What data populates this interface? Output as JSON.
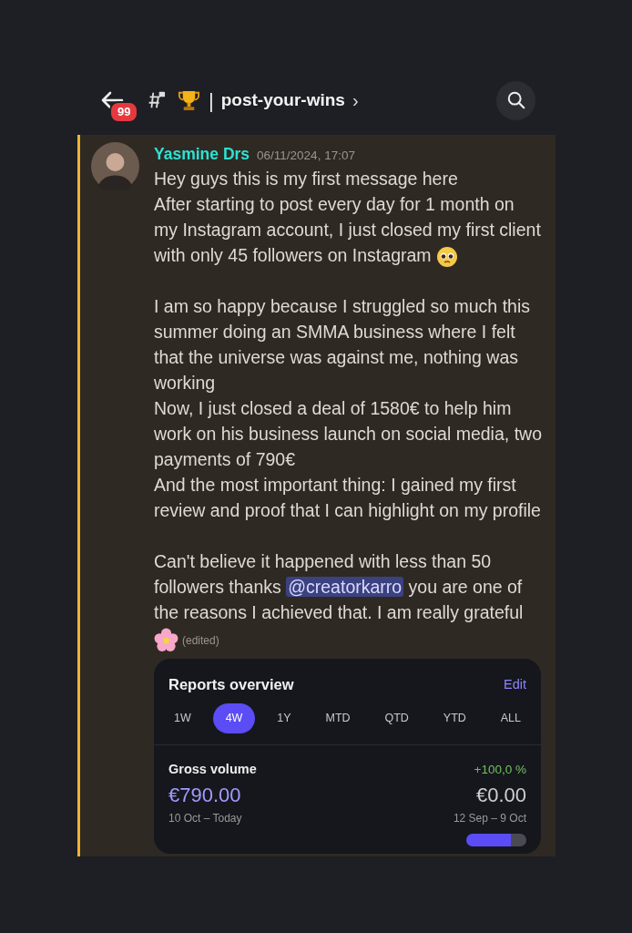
{
  "header": {
    "unread_badge": "99",
    "separator": "|",
    "channel_name": "post-your-wins",
    "chevron": "›"
  },
  "message": {
    "author": "Yasmine Drs",
    "timestamp": "06/11/2024, 17:07",
    "edited": "(edited)",
    "paragraphs": [
      {
        "lines": [
          {
            "text": "Hey guys this is my first message here",
            "end_icon": false
          },
          {
            "text": "After starting to post every day for 1 month on my Instagram account,  I just closed my first client with only 45 followers on Instagram",
            "end_icon": true
          }
        ]
      },
      {
        "lines": [
          {
            "text": "I am so happy because I struggled so much this summer doing an SMMA business where I felt that the universe was against me, nothing was working",
            "end_icon": false
          },
          {
            "text": "Now, I just closed a deal of 1580€ to help him work on his business launch on social media, two payments of 790€",
            "end_icon": false
          },
          {
            "text": "And the most important thing: I gained my first review and proof that I can highlight on my profile",
            "end_icon": false
          }
        ]
      },
      {
        "lines": [
          {
            "parts": [
              {
                "kind": "text",
                "text": "Can't believe it happened with less than 50 followers thanks "
              },
              {
                "kind": "mention",
                "text": "@creatorkarro"
              },
              {
                "kind": "text",
                "text": " you are one of the reasons I achieved that. I am really grateful"
              }
            ],
            "end_icon": true
          }
        ]
      }
    ],
    "card": {
      "title": "Reports overview",
      "action": "Edit",
      "tabs": [
        {
          "label": "1W",
          "selected": false
        },
        {
          "label": "4W",
          "selected": true
        },
        {
          "label": "1Y",
          "selected": false
        },
        {
          "label": "MTD",
          "selected": false
        },
        {
          "label": "QTD",
          "selected": false
        },
        {
          "label": "YTD",
          "selected": false
        },
        {
          "label": "ALL",
          "selected": false
        }
      ],
      "metric": {
        "label": "Gross volume",
        "change": "+100,0 %",
        "current_value": "€790.00",
        "previous_value": "€0.00",
        "current_period": "10 Oct – Today",
        "previous_period": "12 Sep – 9 Oct"
      }
    }
  }
}
